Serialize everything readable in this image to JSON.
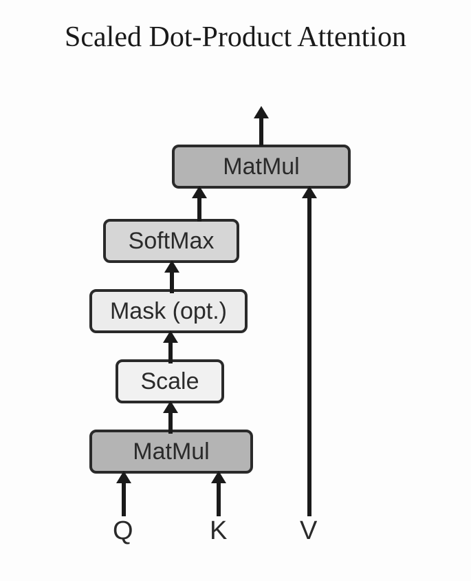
{
  "title": "Scaled Dot-Product Attention",
  "blocks": {
    "matmul_top": "MatMul",
    "softmax": "SoftMax",
    "mask": "Mask (opt.)",
    "scale": "Scale",
    "matmul_bottom": "MatMul"
  },
  "inputs": {
    "q": "Q",
    "k": "K",
    "v": "V"
  }
}
